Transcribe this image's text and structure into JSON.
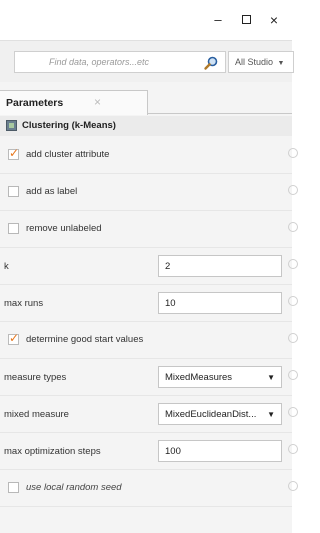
{
  "window": {
    "minimize": "–",
    "close": "×"
  },
  "toolbar": {
    "search_placeholder": "Find data, operators...etc",
    "search_icon": "magnifier-icon",
    "scope_label": "All Studio",
    "scope_arrow": "▼"
  },
  "panel": {
    "tab_label": "Parameters",
    "tab_close": "×",
    "operator_title": "Clustering (k-Means)",
    "operator_icon": "clustering-icon",
    "accent_color": "#e8761c"
  },
  "params": {
    "add_cluster_attribute": {
      "label": "add cluster attribute",
      "checked": true
    },
    "add_as_label": {
      "label": "add as label",
      "checked": false
    },
    "remove_unlabeled": {
      "label": "remove unlabeled",
      "checked": false
    },
    "k": {
      "label": "k",
      "value": "2"
    },
    "max_runs": {
      "label": "max runs",
      "value": "10"
    },
    "determine_good_start_values": {
      "label": "determine good start values",
      "checked": true
    },
    "measure_types": {
      "label": "measure types",
      "value": "MixedMeasures",
      "arrow": "▼"
    },
    "mixed_measure": {
      "label": "mixed measure",
      "value": "MixedEuclideanDist...",
      "arrow": "▼"
    },
    "max_optimization_steps": {
      "label": "max optimization steps",
      "value": "100"
    },
    "use_local_random_seed": {
      "label": "use local random seed",
      "checked": false
    }
  }
}
